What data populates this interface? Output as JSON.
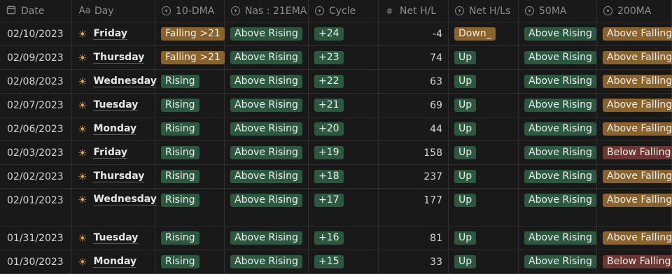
{
  "columns": [
    {
      "key": "date",
      "label": "Date",
      "icon": "calendar-icon"
    },
    {
      "key": "day",
      "label": "Day",
      "icon": "text-property-icon",
      "icon_text": "Aa"
    },
    {
      "key": "dma10",
      "label": "10-DMA",
      "icon": "select-property-icon"
    },
    {
      "key": "nas21",
      "label": "Nas : 21EMA",
      "icon": "select-property-icon"
    },
    {
      "key": "cycle",
      "label": "Cycle",
      "icon": "select-property-icon"
    },
    {
      "key": "nethl",
      "label": "Net H/L",
      "icon": "number-property-icon",
      "icon_text": "#"
    },
    {
      "key": "nethls",
      "label": "Net H/Ls",
      "icon": "select-property-icon"
    },
    {
      "key": "ma50",
      "label": "50MA",
      "icon": "select-property-icon"
    },
    {
      "key": "ma200",
      "label": "200MA",
      "icon": "select-property-icon"
    }
  ],
  "colors": {
    "green": "#2b593f",
    "brown": "#89632a",
    "red": "#6e3630",
    "sun": "#e8a33a"
  },
  "rows": [
    {
      "date": "02/10/2023",
      "day": "Friday",
      "dma10": {
        "text": "Falling >21",
        "color": "brown"
      },
      "nas21": {
        "text": "Above Rising",
        "color": "green"
      },
      "cycle": {
        "text": "+24",
        "color": "green"
      },
      "nethl": "-4",
      "nethls": {
        "text": "Down_",
        "color": "brown"
      },
      "ma50": {
        "text": "Above Rising",
        "color": "green"
      },
      "ma200": {
        "text": "Above Falling",
        "color": "brown"
      }
    },
    {
      "date": "02/09/2023",
      "day": "Thursday",
      "dma10": {
        "text": "Falling >21",
        "color": "brown"
      },
      "nas21": {
        "text": "Above Rising",
        "color": "green"
      },
      "cycle": {
        "text": "+23",
        "color": "green"
      },
      "nethl": "74",
      "nethls": {
        "text": "Up",
        "color": "green"
      },
      "ma50": {
        "text": "Above Rising",
        "color": "green"
      },
      "ma200": {
        "text": "Above Falling",
        "color": "brown"
      }
    },
    {
      "date": "02/08/2023",
      "day": "Wednesday",
      "dma10": {
        "text": "Rising",
        "color": "green"
      },
      "nas21": {
        "text": "Above Rising",
        "color": "green"
      },
      "cycle": {
        "text": "+22",
        "color": "green"
      },
      "nethl": "63",
      "nethls": {
        "text": "Up",
        "color": "green"
      },
      "ma50": {
        "text": "Above Rising",
        "color": "green"
      },
      "ma200": {
        "text": "Above Falling",
        "color": "brown"
      }
    },
    {
      "date": "02/07/2023",
      "day": "Tuesday",
      "dma10": {
        "text": "Rising",
        "color": "green"
      },
      "nas21": {
        "text": "Above Rising",
        "color": "green"
      },
      "cycle": {
        "text": "+21",
        "color": "green"
      },
      "nethl": "69",
      "nethls": {
        "text": "Up",
        "color": "green"
      },
      "ma50": {
        "text": "Above Rising",
        "color": "green"
      },
      "ma200": {
        "text": "Above Falling",
        "color": "brown"
      }
    },
    {
      "date": "02/06/2023",
      "day": "Monday",
      "dma10": {
        "text": "Rising",
        "color": "green"
      },
      "nas21": {
        "text": "Above Rising",
        "color": "green"
      },
      "cycle": {
        "text": "+20",
        "color": "green"
      },
      "nethl": "44",
      "nethls": {
        "text": "Up",
        "color": "green"
      },
      "ma50": {
        "text": "Above Rising",
        "color": "green"
      },
      "ma200": {
        "text": "Above Falling",
        "color": "brown"
      }
    },
    {
      "date": "02/03/2023",
      "day": "Friday",
      "dma10": {
        "text": "Rising",
        "color": "green"
      },
      "nas21": {
        "text": "Above Rising",
        "color": "green"
      },
      "cycle": {
        "text": "+19",
        "color": "green"
      },
      "nethl": "158",
      "nethls": {
        "text": "Up",
        "color": "green"
      },
      "ma50": {
        "text": "Above Rising",
        "color": "green"
      },
      "ma200": {
        "text": "Below Falling",
        "color": "red"
      }
    },
    {
      "date": "02/02/2023",
      "day": "Thursday",
      "dma10": {
        "text": "Rising",
        "color": "green"
      },
      "nas21": {
        "text": "Above Rising",
        "color": "green"
      },
      "cycle": {
        "text": "+18",
        "color": "green"
      },
      "nethl": "237",
      "nethls": {
        "text": "Up",
        "color": "green"
      },
      "ma50": {
        "text": "Above Rising",
        "color": "green"
      },
      "ma200": {
        "text": "Above Falling",
        "color": "brown"
      }
    },
    {
      "date": "02/01/2023",
      "day": "Wednesday",
      "dma10": {
        "text": "Rising",
        "color": "green"
      },
      "nas21": {
        "text": "Above Rising",
        "color": "green"
      },
      "cycle": {
        "text": "+17",
        "color": "green"
      },
      "nethl": "177",
      "nethls": {
        "text": "Up",
        "color": "green"
      },
      "ma50": {
        "text": "Above Rising",
        "color": "green"
      },
      "ma200": {
        "text": "Above Falling",
        "color": "brown"
      }
    },
    {
      "date": "01/31/2023",
      "day": "Tuesday",
      "dma10": {
        "text": "Rising",
        "color": "green"
      },
      "nas21": {
        "text": "Above Rising",
        "color": "green"
      },
      "cycle": {
        "text": "+16",
        "color": "green"
      },
      "nethl": "81",
      "nethls": {
        "text": "Up",
        "color": "green"
      },
      "ma50": {
        "text": "Above Rising",
        "color": "green"
      },
      "ma200": {
        "text": "Above Falling",
        "color": "brown"
      }
    },
    {
      "date": "01/30/2023",
      "day": "Monday",
      "dma10": {
        "text": "Rising",
        "color": "green"
      },
      "nas21": {
        "text": "Above Rising",
        "color": "green"
      },
      "cycle": {
        "text": "+15",
        "color": "green"
      },
      "nethl": "33",
      "nethls": {
        "text": "Up",
        "color": "green"
      },
      "ma50": {
        "text": "Above Rising",
        "color": "green"
      },
      "ma200": {
        "text": "Below Falling",
        "color": "red"
      }
    }
  ]
}
